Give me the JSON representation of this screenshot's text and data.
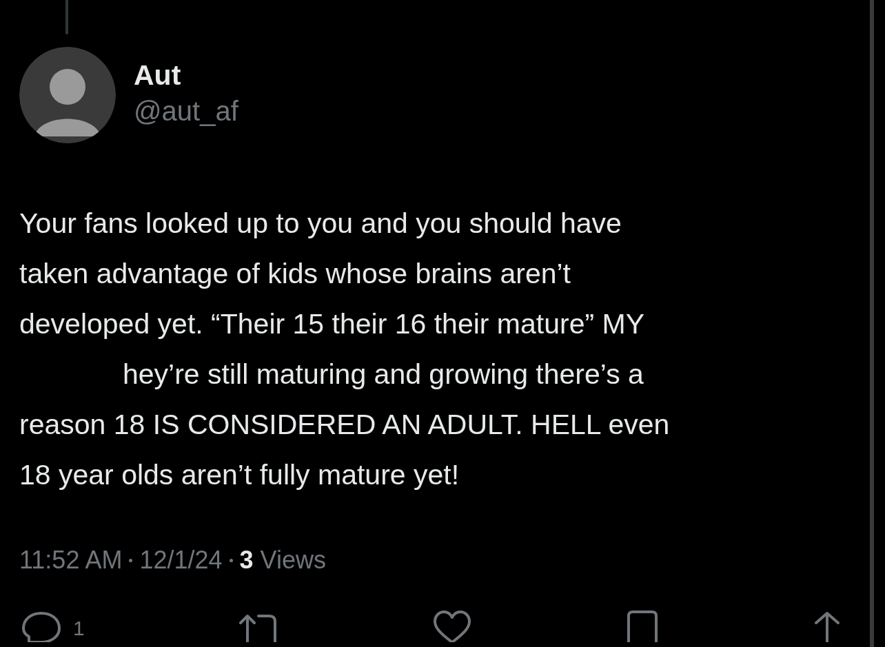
{
  "author": {
    "name": "Aut",
    "handle": "@aut_af"
  },
  "body_lines": [
    "Your fans looked up to you and you should have",
    "taken advantage of kids whose brains aren’t",
    "developed yet. “Their 15 their 16 their mature” MY",
    "hey’re still maturing and growing there’s a",
    "reason 18 IS CONSIDERED AN ADULT. HELL even",
    "18 year olds aren’t fully mature yet!"
  ],
  "meta": {
    "time": "11:52 AM",
    "date": "12/1/24",
    "views_count": "3",
    "views_label": "Views"
  },
  "actions": [
    {
      "kind": "reply",
      "count": "1"
    },
    {
      "kind": "repost"
    },
    {
      "kind": "like"
    },
    {
      "kind": "bookmark"
    },
    {
      "kind": "share"
    }
  ]
}
